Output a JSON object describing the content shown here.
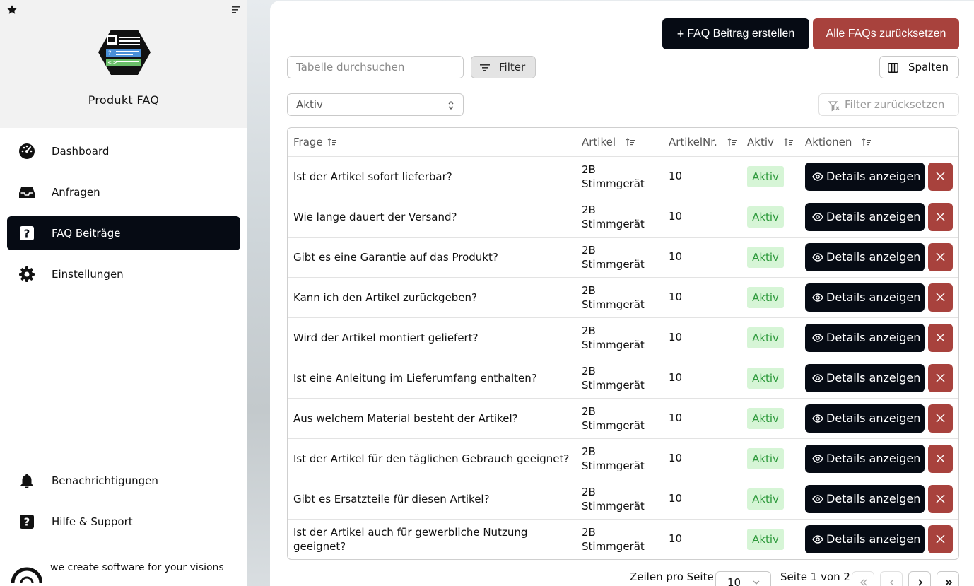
{
  "sidebar": {
    "app_title": "Produkt FAQ",
    "nav": [
      {
        "label": "Dashboard",
        "icon": "dashboard-gauge-icon"
      },
      {
        "label": "Anfragen",
        "icon": "inbox-icon"
      },
      {
        "label": "FAQ Beiträge",
        "icon": "question-box-icon",
        "active": true
      },
      {
        "label": "Einstellungen",
        "icon": "gear-icon"
      }
    ],
    "bottom_nav": [
      {
        "label": "Benachrichtigungen",
        "icon": "bell-icon"
      },
      {
        "label": "Hilfe & Support",
        "icon": "question-box-icon"
      }
    ],
    "brand_text": "we create software for your visions"
  },
  "toolbar": {
    "create_label": "FAQ Beitrag erstellen",
    "create_prefix": "+",
    "reset_all_label": "Alle FAQs zurücksetzen",
    "search_placeholder": "Tabelle durchsuchen",
    "filter_label": "Filter",
    "columns_label": "Spalten",
    "status_select_value": "Aktiv",
    "reset_filter_label": "Filter zurücksetzen"
  },
  "table": {
    "columns": [
      "Frage",
      "Artikel",
      "ArtikelNr.",
      "Aktiv",
      "Aktionen"
    ],
    "details_label": "Details anzeigen",
    "rows": [
      {
        "frage": "Ist der Artikel sofort lieferbar?",
        "artikel_1": "2B",
        "artikel_2": "Stimmgerät",
        "nr": "10",
        "aktiv": "Aktiv"
      },
      {
        "frage": "Wie lange dauert der Versand?",
        "artikel_1": "2B",
        "artikel_2": "Stimmgerät",
        "nr": "10",
        "aktiv": "Aktiv"
      },
      {
        "frage": "Gibt es eine Garantie auf das Produkt?",
        "artikel_1": "2B",
        "artikel_2": "Stimmgerät",
        "nr": "10",
        "aktiv": "Aktiv"
      },
      {
        "frage": "Kann ich den Artikel zurückgeben?",
        "artikel_1": "2B",
        "artikel_2": "Stimmgerät",
        "nr": "10",
        "aktiv": "Aktiv"
      },
      {
        "frage": "Wird der Artikel montiert geliefert?",
        "artikel_1": "2B",
        "artikel_2": "Stimmgerät",
        "nr": "10",
        "aktiv": "Aktiv"
      },
      {
        "frage": "Ist eine Anleitung im Lieferumfang enthalten?",
        "artikel_1": "2B",
        "artikel_2": "Stimmgerät",
        "nr": "10",
        "aktiv": "Aktiv"
      },
      {
        "frage": "Aus welchem Material besteht der Artikel?",
        "artikel_1": "2B",
        "artikel_2": "Stimmgerät",
        "nr": "10",
        "aktiv": "Aktiv"
      },
      {
        "frage": "Ist der Artikel für den täglichen Gebrauch geeignet?",
        "artikel_1": "2B",
        "artikel_2": "Stimmgerät",
        "nr": "10",
        "aktiv": "Aktiv"
      },
      {
        "frage": "Gibt es Ersatzteile für diesen Artikel?",
        "artikel_1": "2B",
        "artikel_2": "Stimmgerät",
        "nr": "10",
        "aktiv": "Aktiv"
      },
      {
        "frage": "Ist der Artikel auch für gewerbliche Nutzung geeignet?",
        "artikel_1": "2B",
        "artikel_2": "Stimmgerät",
        "nr": "10",
        "aktiv": "Aktiv"
      }
    ]
  },
  "pagination": {
    "rows_per_page_label": "Zeilen pro Seite",
    "rows_per_page_value": "10",
    "page_info": "Seite 1 von 2"
  },
  "colors": {
    "primary_dark": "#060b14",
    "danger": "#a8423d",
    "badge_bg": "#d6f5d6",
    "badge_text": "#2e9a3c"
  }
}
